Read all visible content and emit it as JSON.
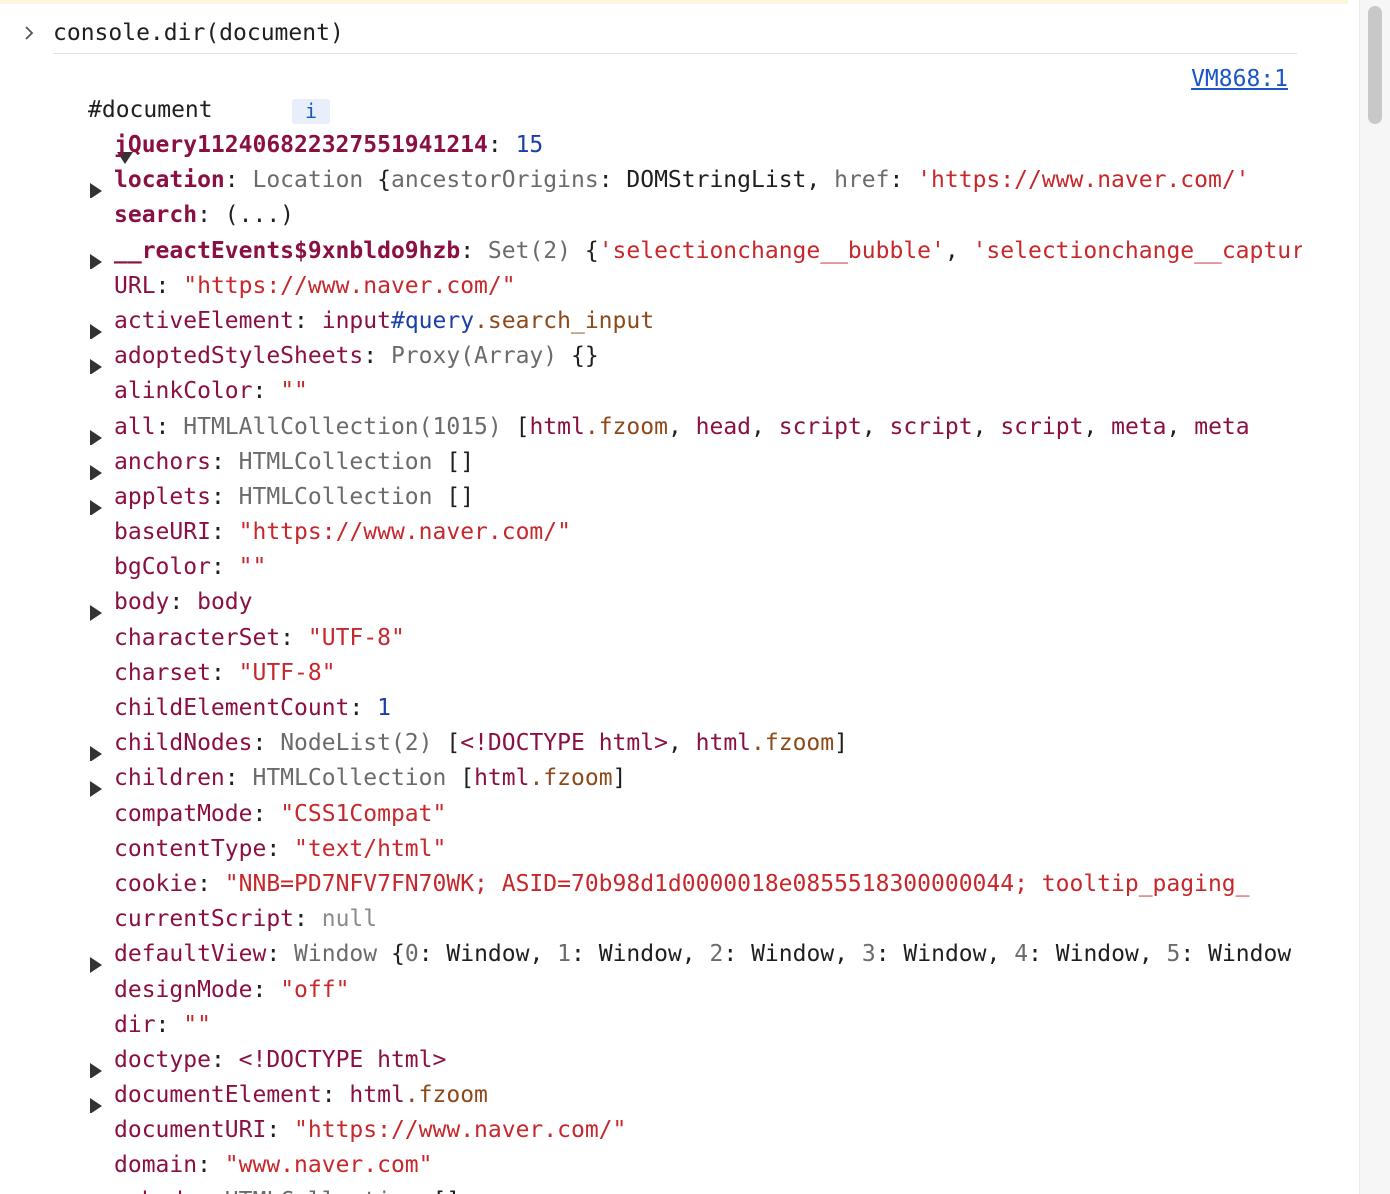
{
  "console": {
    "input_text": "console.dir(document)",
    "source_link": "VM868:1",
    "root_label": "#document",
    "info_badge": "i"
  },
  "properties": [
    {
      "expandable": false,
      "own": true,
      "parts": [
        {
          "t": "jQuery112406822327551941214",
          "c": "k-own"
        },
        {
          "t": ": ",
          "c": "p"
        },
        {
          "t": "15",
          "c": "n"
        }
      ]
    },
    {
      "expandable": true,
      "own": true,
      "parts": [
        {
          "t": "location",
          "c": "k-own"
        },
        {
          "t": ": ",
          "c": "p"
        },
        {
          "t": "Location ",
          "c": "cls"
        },
        {
          "t": "{",
          "c": "p"
        },
        {
          "t": "ancestorOrigins",
          "c": "cls"
        },
        {
          "t": ": DOMStringList, ",
          "c": "p"
        },
        {
          "t": "href",
          "c": "cls"
        },
        {
          "t": ": ",
          "c": "p"
        },
        {
          "t": "'https://www.naver.com/'",
          "c": "s"
        }
      ]
    },
    {
      "expandable": false,
      "own": true,
      "parts": [
        {
          "t": "search",
          "c": "k-own"
        },
        {
          "t": ": (...)",
          "c": "p"
        }
      ]
    },
    {
      "expandable": true,
      "own": true,
      "parts": [
        {
          "t": "__reactEvents$9xnbldo9hzb",
          "c": "k-own"
        },
        {
          "t": ": ",
          "c": "p"
        },
        {
          "t": "Set(2) ",
          "c": "cls"
        },
        {
          "t": "{",
          "c": "p"
        },
        {
          "t": "'selectionchange__bubble'",
          "c": "s"
        },
        {
          "t": ", ",
          "c": "p"
        },
        {
          "t": "'selectionchange__capture'",
          "c": "s"
        }
      ]
    },
    {
      "expandable": false,
      "own": false,
      "parts": [
        {
          "t": "URL",
          "c": "k"
        },
        {
          "t": ": ",
          "c": "p"
        },
        {
          "t": "\"https://www.naver.com/\"",
          "c": "s"
        }
      ]
    },
    {
      "expandable": true,
      "own": false,
      "parts": [
        {
          "t": "activeElement",
          "c": "k"
        },
        {
          "t": ": ",
          "c": "p"
        },
        {
          "t": "input",
          "c": "tg"
        },
        {
          "t": "#query",
          "c": "id"
        },
        {
          "t": ".search_input",
          "c": "cl"
        }
      ]
    },
    {
      "expandable": true,
      "own": false,
      "parts": [
        {
          "t": "adoptedStyleSheets",
          "c": "k"
        },
        {
          "t": ": ",
          "c": "p"
        },
        {
          "t": "Proxy(Array) ",
          "c": "cls"
        },
        {
          "t": "{}",
          "c": "p"
        }
      ]
    },
    {
      "expandable": false,
      "own": false,
      "parts": [
        {
          "t": "alinkColor",
          "c": "k"
        },
        {
          "t": ": ",
          "c": "p"
        },
        {
          "t": "\"\"",
          "c": "s"
        }
      ]
    },
    {
      "expandable": true,
      "own": false,
      "parts": [
        {
          "t": "all",
          "c": "k"
        },
        {
          "t": ": ",
          "c": "p"
        },
        {
          "t": "HTMLAllCollection(1015) ",
          "c": "cls"
        },
        {
          "t": "[",
          "c": "p"
        },
        {
          "t": "html",
          "c": "tg"
        },
        {
          "t": ".fzoom",
          "c": "cl"
        },
        {
          "t": ", ",
          "c": "p"
        },
        {
          "t": "head",
          "c": "tg"
        },
        {
          "t": ", ",
          "c": "p"
        },
        {
          "t": "script",
          "c": "tg"
        },
        {
          "t": ", ",
          "c": "p"
        },
        {
          "t": "script",
          "c": "tg"
        },
        {
          "t": ", ",
          "c": "p"
        },
        {
          "t": "script",
          "c": "tg"
        },
        {
          "t": ", ",
          "c": "p"
        },
        {
          "t": "meta",
          "c": "tg"
        },
        {
          "t": ", ",
          "c": "p"
        },
        {
          "t": "meta",
          "c": "tg"
        }
      ]
    },
    {
      "expandable": true,
      "own": false,
      "parts": [
        {
          "t": "anchors",
          "c": "k"
        },
        {
          "t": ": ",
          "c": "p"
        },
        {
          "t": "HTMLCollection ",
          "c": "cls"
        },
        {
          "t": "[]",
          "c": "p"
        }
      ]
    },
    {
      "expandable": true,
      "own": false,
      "parts": [
        {
          "t": "applets",
          "c": "k"
        },
        {
          "t": ": ",
          "c": "p"
        },
        {
          "t": "HTMLCollection ",
          "c": "cls"
        },
        {
          "t": "[]",
          "c": "p"
        }
      ]
    },
    {
      "expandable": false,
      "own": false,
      "parts": [
        {
          "t": "baseURI",
          "c": "k"
        },
        {
          "t": ": ",
          "c": "p"
        },
        {
          "t": "\"https://www.naver.com/\"",
          "c": "s"
        }
      ]
    },
    {
      "expandable": false,
      "own": false,
      "parts": [
        {
          "t": "bgColor",
          "c": "k"
        },
        {
          "t": ": ",
          "c": "p"
        },
        {
          "t": "\"\"",
          "c": "s"
        }
      ]
    },
    {
      "expandable": true,
      "own": false,
      "parts": [
        {
          "t": "body",
          "c": "k"
        },
        {
          "t": ": ",
          "c": "p"
        },
        {
          "t": "body",
          "c": "tg"
        }
      ]
    },
    {
      "expandable": false,
      "own": false,
      "parts": [
        {
          "t": "characterSet",
          "c": "k"
        },
        {
          "t": ": ",
          "c": "p"
        },
        {
          "t": "\"UTF-8\"",
          "c": "s"
        }
      ]
    },
    {
      "expandable": false,
      "own": false,
      "parts": [
        {
          "t": "charset",
          "c": "k"
        },
        {
          "t": ": ",
          "c": "p"
        },
        {
          "t": "\"UTF-8\"",
          "c": "s"
        }
      ]
    },
    {
      "expandable": false,
      "own": false,
      "parts": [
        {
          "t": "childElementCount",
          "c": "k"
        },
        {
          "t": ": ",
          "c": "p"
        },
        {
          "t": "1",
          "c": "n"
        }
      ]
    },
    {
      "expandable": true,
      "own": false,
      "parts": [
        {
          "t": "childNodes",
          "c": "k"
        },
        {
          "t": ": ",
          "c": "p"
        },
        {
          "t": "NodeList(2) ",
          "c": "cls"
        },
        {
          "t": "[",
          "c": "p"
        },
        {
          "t": "<!DOCTYPE html>",
          "c": "tg"
        },
        {
          "t": ", ",
          "c": "p"
        },
        {
          "t": "html",
          "c": "tg"
        },
        {
          "t": ".fzoom",
          "c": "cl"
        },
        {
          "t": "]",
          "c": "p"
        }
      ]
    },
    {
      "expandable": true,
      "own": false,
      "parts": [
        {
          "t": "children",
          "c": "k"
        },
        {
          "t": ": ",
          "c": "p"
        },
        {
          "t": "HTMLCollection ",
          "c": "cls"
        },
        {
          "t": "[",
          "c": "p"
        },
        {
          "t": "html",
          "c": "tg"
        },
        {
          "t": ".fzoom",
          "c": "cl"
        },
        {
          "t": "]",
          "c": "p"
        }
      ]
    },
    {
      "expandable": false,
      "own": false,
      "parts": [
        {
          "t": "compatMode",
          "c": "k"
        },
        {
          "t": ": ",
          "c": "p"
        },
        {
          "t": "\"CSS1Compat\"",
          "c": "s"
        }
      ]
    },
    {
      "expandable": false,
      "own": false,
      "parts": [
        {
          "t": "contentType",
          "c": "k"
        },
        {
          "t": ": ",
          "c": "p"
        },
        {
          "t": "\"text/html\"",
          "c": "s"
        }
      ]
    },
    {
      "expandable": false,
      "own": false,
      "parts": [
        {
          "t": "cookie",
          "c": "k"
        },
        {
          "t": ": ",
          "c": "p"
        },
        {
          "t": "\"NNB=PD7NFV7FN70WK; ASID=70b98d1d0000018e0855518300000044; tooltip_paging_",
          "c": "s"
        }
      ]
    },
    {
      "expandable": false,
      "own": false,
      "parts": [
        {
          "t": "currentScript",
          "c": "k"
        },
        {
          "t": ": ",
          "c": "p"
        },
        {
          "t": "null",
          "c": "nul"
        }
      ]
    },
    {
      "expandable": true,
      "own": false,
      "parts": [
        {
          "t": "defaultView",
          "c": "k"
        },
        {
          "t": ": ",
          "c": "p"
        },
        {
          "t": "Window ",
          "c": "cls"
        },
        {
          "t": "{",
          "c": "p"
        },
        {
          "t": "0",
          "c": "cls"
        },
        {
          "t": ": Window, ",
          "c": "p"
        },
        {
          "t": "1",
          "c": "cls"
        },
        {
          "t": ": Window, ",
          "c": "p"
        },
        {
          "t": "2",
          "c": "cls"
        },
        {
          "t": ": Window, ",
          "c": "p"
        },
        {
          "t": "3",
          "c": "cls"
        },
        {
          "t": ": Window, ",
          "c": "p"
        },
        {
          "t": "4",
          "c": "cls"
        },
        {
          "t": ": Window, ",
          "c": "p"
        },
        {
          "t": "5",
          "c": "cls"
        },
        {
          "t": ": Window",
          "c": "p"
        }
      ]
    },
    {
      "expandable": false,
      "own": false,
      "parts": [
        {
          "t": "designMode",
          "c": "k"
        },
        {
          "t": ": ",
          "c": "p"
        },
        {
          "t": "\"off\"",
          "c": "s"
        }
      ]
    },
    {
      "expandable": false,
      "own": false,
      "parts": [
        {
          "t": "dir",
          "c": "k"
        },
        {
          "t": ": ",
          "c": "p"
        },
        {
          "t": "\"\"",
          "c": "s"
        }
      ]
    },
    {
      "expandable": true,
      "own": false,
      "parts": [
        {
          "t": "doctype",
          "c": "k"
        },
        {
          "t": ": ",
          "c": "p"
        },
        {
          "t": "<!DOCTYPE html>",
          "c": "tg"
        }
      ]
    },
    {
      "expandable": true,
      "own": false,
      "parts": [
        {
          "t": "documentElement",
          "c": "k"
        },
        {
          "t": ": ",
          "c": "p"
        },
        {
          "t": "html",
          "c": "tg"
        },
        {
          "t": ".fzoom",
          "c": "cl"
        }
      ]
    },
    {
      "expandable": false,
      "own": false,
      "parts": [
        {
          "t": "documentURI",
          "c": "k"
        },
        {
          "t": ": ",
          "c": "p"
        },
        {
          "t": "\"https://www.naver.com/\"",
          "c": "s"
        }
      ]
    },
    {
      "expandable": false,
      "own": false,
      "parts": [
        {
          "t": "domain",
          "c": "k"
        },
        {
          "t": ": ",
          "c": "p"
        },
        {
          "t": "\"www.naver.com\"",
          "c": "s"
        }
      ]
    },
    {
      "expandable": true,
      "own": false,
      "parts": [
        {
          "t": "embeds",
          "c": "k"
        },
        {
          "t": ": ",
          "c": "p"
        },
        {
          "t": "HTMLCollection ",
          "c": "cls"
        },
        {
          "t": "[]",
          "c": "p"
        }
      ]
    }
  ]
}
